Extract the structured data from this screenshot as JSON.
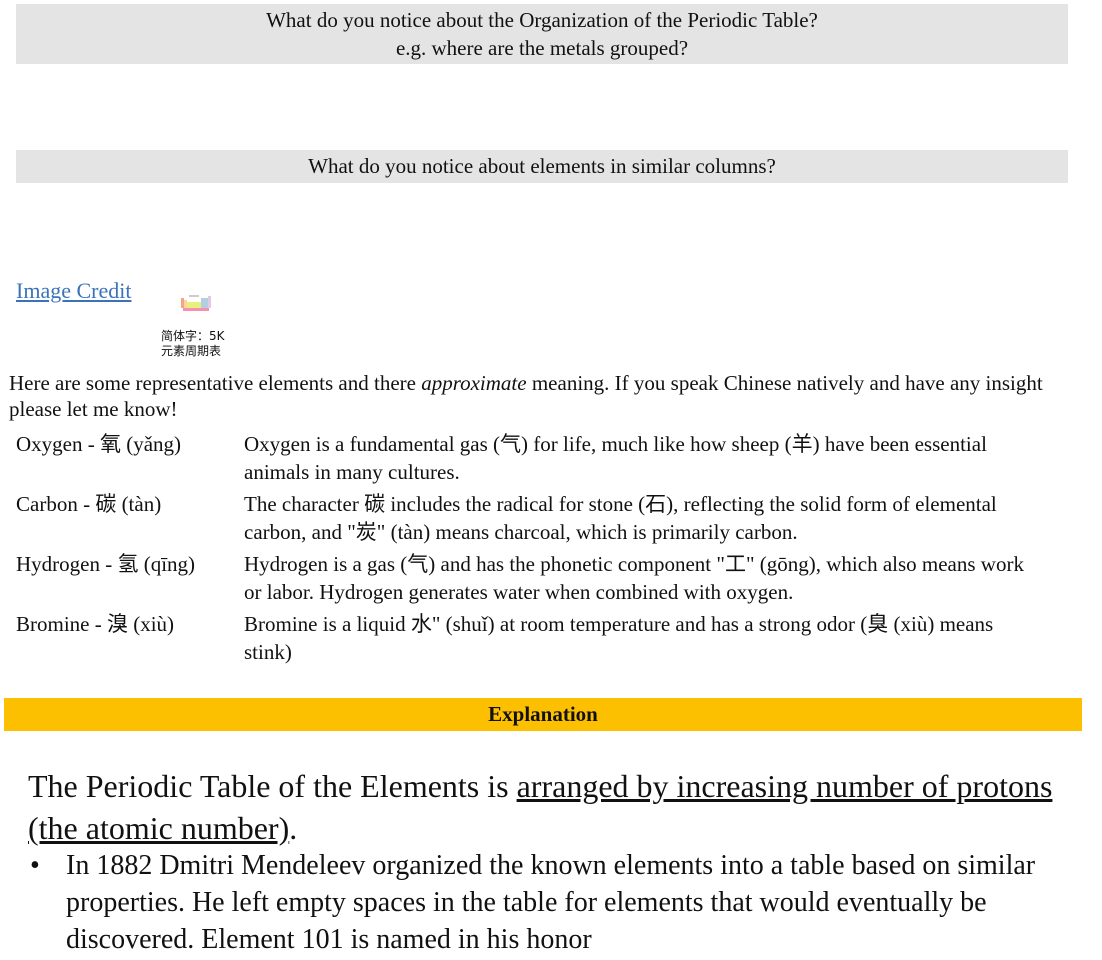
{
  "questions": {
    "q1_line1": "What do you notice about the Organization of the Periodic Table?",
    "q1_line2": "e.g. where are the metals grouped?",
    "q2": "What do you notice about elements in similar columns?"
  },
  "credit": {
    "link_label": "Image Credit",
    "thumbnail_icon": "periodic-table-thumbnail",
    "caption_line1": "简体字：5K",
    "caption_line2": "元素周期表"
  },
  "intro": {
    "before": "Here are some representative elements and there ",
    "emphasis": "approximate",
    "after": " meaning. If you speak Chinese natively and have any insight please let me know!"
  },
  "elements": [
    {
      "name": "Oxygen - 氧 (yǎng)",
      "description": "Oxygen is a fundamental gas (气) for life, much like how sheep (羊) have been essential animals in many cultures."
    },
    {
      "name": "Carbon - 碳 (tàn)",
      "description": "The character 碳 includes the radical for stone (石), reflecting the solid form of elemental carbon, and \"炭\" (tàn) means charcoal, which is primarily carbon."
    },
    {
      "name": "Hydrogen - 氢 (qīng)",
      "description": "Hydrogen is a gas (气) and has the phonetic component \"工\" (gōng), which also means work or labor. Hydrogen generates water when combined with oxygen."
    },
    {
      "name": "Bromine - 溴 (xiù)",
      "description": "Bromine is a liquid 水\" (shuǐ) at room temperature and has a strong odor (臭 (xiù) means stink)"
    }
  ],
  "explanation": {
    "heading": "Explanation",
    "lead_plain": "The Periodic Table of the Elements is ",
    "lead_underlined": "arranged by increasing number of protons (the atomic number)",
    "lead_end": ".",
    "bullets": [
      "In 1882 Dmitri Mendeleev organized the known elements into a table based on similar properties. He left empty spaces in the table for elements that would eventually be discovered. Element 101 is named in his honor"
    ]
  },
  "colors": {
    "question_bg": "#e4e4e4",
    "explanation_bg": "#fdc000",
    "link": "#3b73b9"
  }
}
